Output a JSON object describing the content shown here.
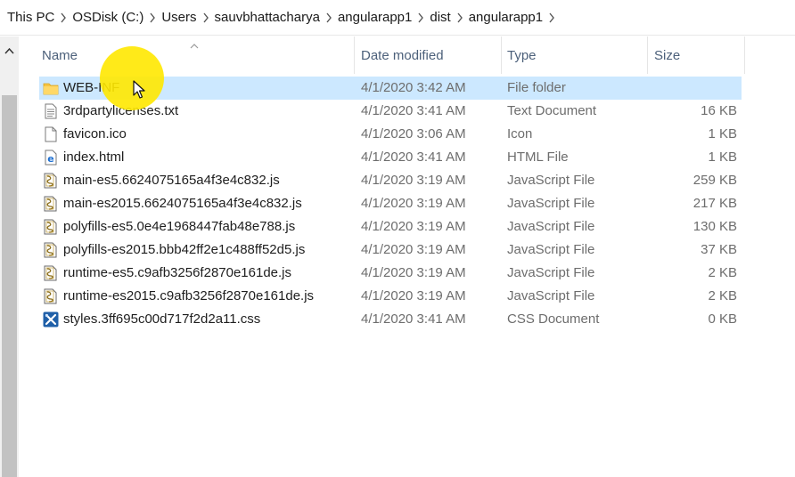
{
  "breadcrumb": {
    "items": [
      "This PC",
      "OSDisk (C:)",
      "Users",
      "sauvbhattacharya",
      "angularapp1",
      "dist",
      "angularapp1"
    ]
  },
  "columns": {
    "name": "Name",
    "date": "Date modified",
    "type": "Type",
    "size": "Size"
  },
  "files": [
    {
      "icon": "folder-icon",
      "name": "WEB-INF",
      "date": "4/1/2020 3:42 AM",
      "type": "File folder",
      "size": ""
    },
    {
      "icon": "text-file-icon",
      "name": "3rdpartylicenses.txt",
      "date": "4/1/2020 3:41 AM",
      "type": "Text Document",
      "size": "16 KB"
    },
    {
      "icon": "blank-file-icon",
      "name": "favicon.ico",
      "date": "4/1/2020 3:06 AM",
      "type": "Icon",
      "size": "1 KB"
    },
    {
      "icon": "edge-html-icon",
      "name": "index.html",
      "date": "4/1/2020 3:41 AM",
      "type": "HTML File",
      "size": "1 KB"
    },
    {
      "icon": "script-file-icon",
      "name": "main-es5.6624075165a4f3e4c832.js",
      "date": "4/1/2020 3:19 AM",
      "type": "JavaScript File",
      "size": "259 KB"
    },
    {
      "icon": "script-file-icon",
      "name": "main-es2015.6624075165a4f3e4c832.js",
      "date": "4/1/2020 3:19 AM",
      "type": "JavaScript File",
      "size": "217 KB"
    },
    {
      "icon": "script-file-icon",
      "name": "polyfills-es5.0e4e1968447fab48e788.js",
      "date": "4/1/2020 3:19 AM",
      "type": "JavaScript File",
      "size": "130 KB"
    },
    {
      "icon": "script-file-icon",
      "name": "polyfills-es2015.bbb42ff2e1c488ff52d5.js",
      "date": "4/1/2020 3:19 AM",
      "type": "JavaScript File",
      "size": "37 KB"
    },
    {
      "icon": "script-file-icon",
      "name": "runtime-es5.c9afb3256f2870e161de.js",
      "date": "4/1/2020 3:19 AM",
      "type": "JavaScript File",
      "size": "2 KB"
    },
    {
      "icon": "script-file-icon",
      "name": "runtime-es2015.c9afb3256f2870e161de.js",
      "date": "4/1/2020 3:19 AM",
      "type": "JavaScript File",
      "size": "2 KB"
    },
    {
      "icon": "css-tools-icon",
      "name": "styles.3ff695c00d717f2d2a11.css",
      "date": "4/1/2020 3:41 AM",
      "type": "CSS Document",
      "size": "0 KB"
    }
  ],
  "selected_index": 0,
  "colors": {
    "selection": "#cce8ff",
    "cursor_highlight": "#ffe800",
    "header_text": "#4c607a"
  }
}
